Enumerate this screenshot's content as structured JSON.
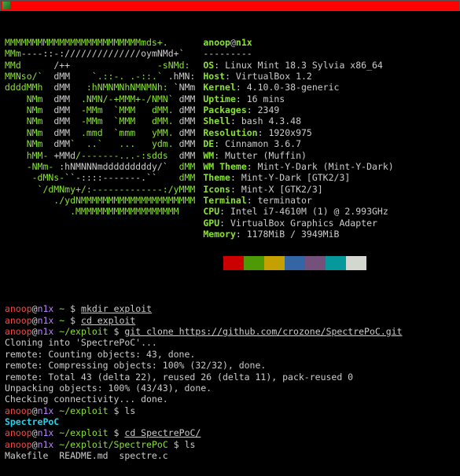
{
  "titlebar": {
    "icon": "mint-icon"
  },
  "ascii": [
    [
      [
        "g",
        "MMMMMMMMMMMMMMMMMMMMMMMMMmds+."
      ]
    ],
    [
      [
        "g",
        "MMm"
      ],
      [
        "w",
        "----::-://////////////oymNMd+`"
      ]
    ],
    [
      [
        "g",
        "MMd      "
      ],
      [
        "w",
        "/++"
      ],
      [
        "g",
        "                -sNMd:"
      ]
    ],
    [
      [
        "g",
        "MMNso/`  "
      ],
      [
        "w",
        "dMM"
      ],
      [
        "g",
        "    `.::-. .-::.` "
      ],
      [
        "w",
        ".hMN:"
      ]
    ],
    [
      [
        "g",
        "ddddMMh  "
      ],
      [
        "w",
        "dMM"
      ],
      [
        "g",
        "   :hNMNMNhNMNMNh: "
      ],
      [
        "w",
        "`NMm"
      ]
    ],
    [
      [
        "g",
        "    NMm  "
      ],
      [
        "w",
        "dMM"
      ],
      [
        "g",
        "  .NMN/-+MMM+-/NMN` "
      ],
      [
        "w",
        "dMM"
      ]
    ],
    [
      [
        "g",
        "    NMm  "
      ],
      [
        "w",
        "dMM"
      ],
      [
        "g",
        "  -MMm  `MMM   dMM. "
      ],
      [
        "w",
        "dMM"
      ]
    ],
    [
      [
        "g",
        "    NMm  "
      ],
      [
        "w",
        "dMM"
      ],
      [
        "g",
        "  -MMm  `MMM   dMM. "
      ],
      [
        "w",
        "dMM"
      ]
    ],
    [
      [
        "g",
        "    NMm  "
      ],
      [
        "w",
        "dMM"
      ],
      [
        "g",
        "  .mmd  `mmm   yMM. "
      ],
      [
        "w",
        "dMM"
      ]
    ],
    [
      [
        "g",
        "    NMm  "
      ],
      [
        "w",
        "dMM"
      ],
      [
        "g",
        "`  ..`   ...   ydm. "
      ],
      [
        "w",
        "dMM"
      ]
    ],
    [
      [
        "g",
        "    hMM- "
      ],
      [
        "w",
        "+MMd"
      ],
      [
        "g",
        "/-------...-:sdds  "
      ],
      [
        "w",
        "dMM"
      ]
    ],
    [
      [
        "g",
        "    -NMm- "
      ],
      [
        "w",
        ":hNMNNNmdddddddddy/`  "
      ],
      [
        "g",
        "dMM"
      ]
    ],
    [
      [
        "g",
        "     -dMNs-"
      ],
      [
        "w",
        "``-::::-------.``    "
      ],
      [
        "g",
        "dMM"
      ]
    ],
    [
      [
        "g",
        "      `/dMNmy+/:-------------:/yMMM"
      ]
    ],
    [
      [
        "g",
        "         ./ydNMMMMMMMMMMMMMMMMMMMMM"
      ]
    ],
    [
      [
        "g",
        "            .MMMMMMMMMMMMMMMMMMM"
      ]
    ]
  ],
  "info": {
    "userhost": "anoop@n1x",
    "sep": "---------",
    "rows": [
      {
        "label": "OS",
        "value": "Linux Mint 18.3 Sylvia x86_64"
      },
      {
        "label": "Host",
        "value": "VirtualBox 1.2"
      },
      {
        "label": "Kernel",
        "value": "4.10.0-38-generic"
      },
      {
        "label": "Uptime",
        "value": "16 mins"
      },
      {
        "label": "Packages",
        "value": "2349"
      },
      {
        "label": "Shell",
        "value": "bash 4.3.48"
      },
      {
        "label": "Resolution",
        "value": "1920x975"
      },
      {
        "label": "DE",
        "value": "Cinnamon 3.6.7"
      },
      {
        "label": "WM",
        "value": "Mutter (Muffin)"
      },
      {
        "label": "WM Theme",
        "value": "Mint-Y-Dark (Mint-Y-Dark)"
      },
      {
        "label": "Theme",
        "value": "Mint-Y-Dark [GTK2/3]"
      },
      {
        "label": "Icons",
        "value": "Mint-X [GTK2/3]"
      },
      {
        "label": "Terminal",
        "value": "terminator"
      },
      {
        "label": "CPU",
        "value": "Intel i7-4610M (1) @ 2.993GHz"
      },
      {
        "label": "GPU",
        "value": "VirtualBox Graphics Adapter"
      },
      {
        "label": "Memory",
        "value": "1178MiB / 3949MiB"
      }
    ],
    "swatches": [
      "#000000",
      "#cc0000",
      "#4e9a06",
      "#c4a000",
      "#3465a4",
      "#75507b",
      "#06989a",
      "#d3d7cf"
    ]
  },
  "user": "anoop",
  "host": "n1x",
  "history": [
    {
      "type": "prompt",
      "path": "~",
      "cmd": "mkdir exploit"
    },
    {
      "type": "prompt",
      "path": "~",
      "cmd": "cd exploit"
    },
    {
      "type": "prompt",
      "path": "~/exploit",
      "cmd": "git clone https://github.com/crozone/SpectrePoC.git"
    },
    {
      "type": "out",
      "text": "Cloning into 'SpectrePoC'..."
    },
    {
      "type": "out",
      "text": "remote: Counting objects: 43, done."
    },
    {
      "type": "out",
      "text": "remote: Compressing objects: 100% (32/32), done."
    },
    {
      "type": "out",
      "text": "remote: Total 43 (delta 22), reused 26 (delta 11), pack-reused 0"
    },
    {
      "type": "out",
      "text": "Unpacking objects: 100% (43/43), done."
    },
    {
      "type": "out",
      "text": "Checking connectivity... done."
    },
    {
      "type": "prompt",
      "path": "~/exploit",
      "cmd": "ls",
      "plain": true
    },
    {
      "type": "cyan",
      "text": "SpectrePoC"
    },
    {
      "type": "prompt",
      "path": "~/exploit",
      "cmd": "cd SpectrePoC/"
    },
    {
      "type": "prompt",
      "path": "~/exploit/SpectrePoC",
      "cmd": "ls",
      "plain": true
    },
    {
      "type": "out",
      "text": "Makefile  README.md  spectre.c"
    }
  ]
}
